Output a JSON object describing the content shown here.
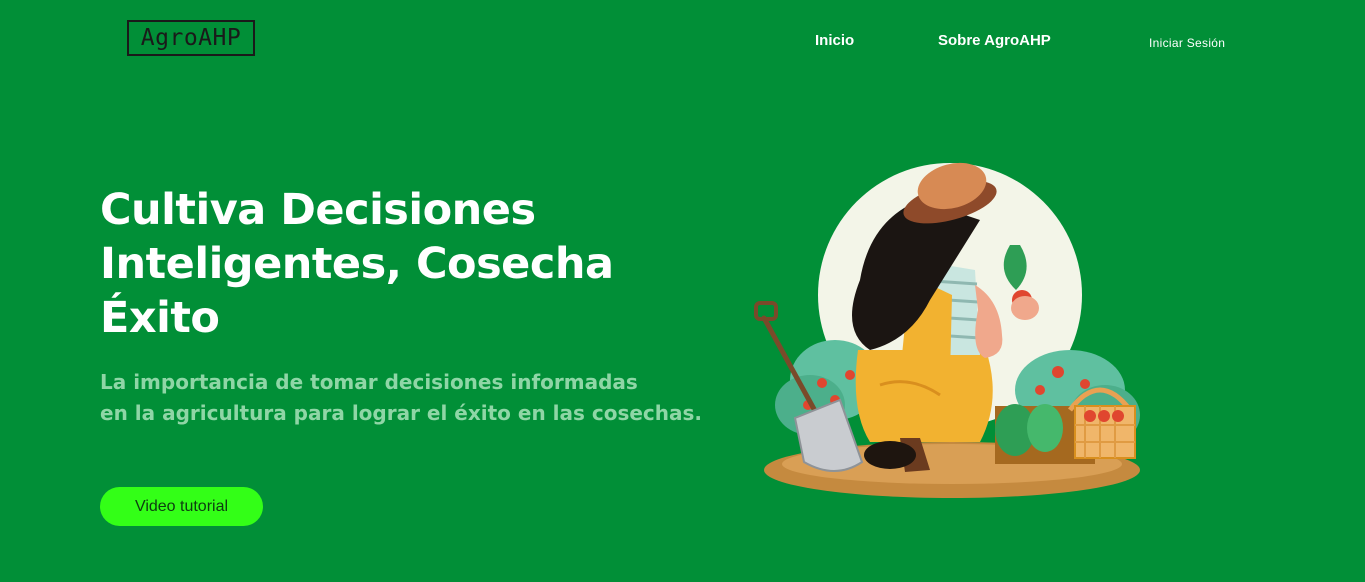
{
  "brand": {
    "logo_text": "AgroAHP"
  },
  "nav": {
    "items": [
      {
        "label": "Inicio"
      },
      {
        "label": "Sobre AgroAHP"
      },
      {
        "label": "Iniciar Sesión"
      }
    ]
  },
  "hero": {
    "title_lines": [
      "Cultiva Decisiones",
      "Inteligentes, Cosecha",
      "Éxito"
    ],
    "subtitle_lines": [
      "La importancia de tomar decisiones informadas",
      "en la agricultura para lograr el éxito en las cosechas."
    ],
    "cta_label": "Video tutorial"
  },
  "colors": {
    "background": "#018f37",
    "cta": "#33ff17",
    "subtitle": "#8fd6a6"
  }
}
